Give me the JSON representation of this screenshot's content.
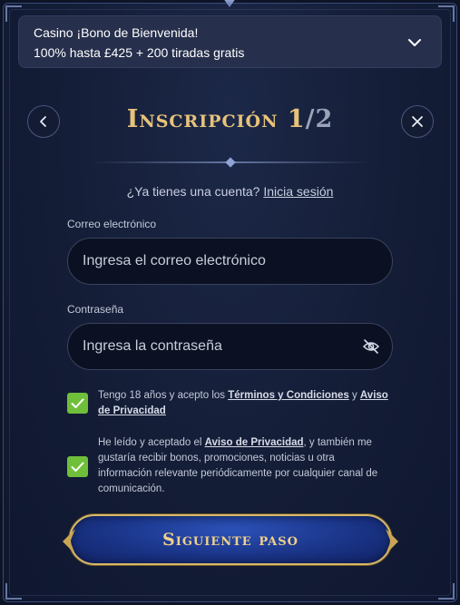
{
  "promo": {
    "line1": "Casino ¡Bono de Bienvenida!",
    "line2": "100% hasta £425 + 200 tiradas gratis"
  },
  "header": {
    "title_main": "Inscripción 1",
    "title_step": "/2"
  },
  "login": {
    "prompt": "¿Ya tienes una cuenta?",
    "link": "Inicia sesión"
  },
  "form": {
    "email_label": "Correo electrónico",
    "email_placeholder": "Ingresa el correo electrónico",
    "password_label": "Contraseña",
    "password_placeholder": "Ingresa la contraseña"
  },
  "consents": {
    "c1_prefix": "Tengo 18 años y acepto los ",
    "c1_link1": "Términos y Condiciones",
    "c1_mid": " y ",
    "c1_link2": "Aviso de Privacidad",
    "c2_prefix": "He leído y aceptado el ",
    "c2_link": "Aviso de Privacidad",
    "c2_suffix": ", y también me gustaría recibir bonos, promociones, noticias u otra información relevante periódicamente por cualquier canal de comunicación."
  },
  "cta": {
    "label": "Siguiente paso"
  },
  "colors": {
    "accent_gold": "#e7c27a",
    "checkbox_green": "#6fbf3a",
    "cta_blue": "#1a3487"
  }
}
